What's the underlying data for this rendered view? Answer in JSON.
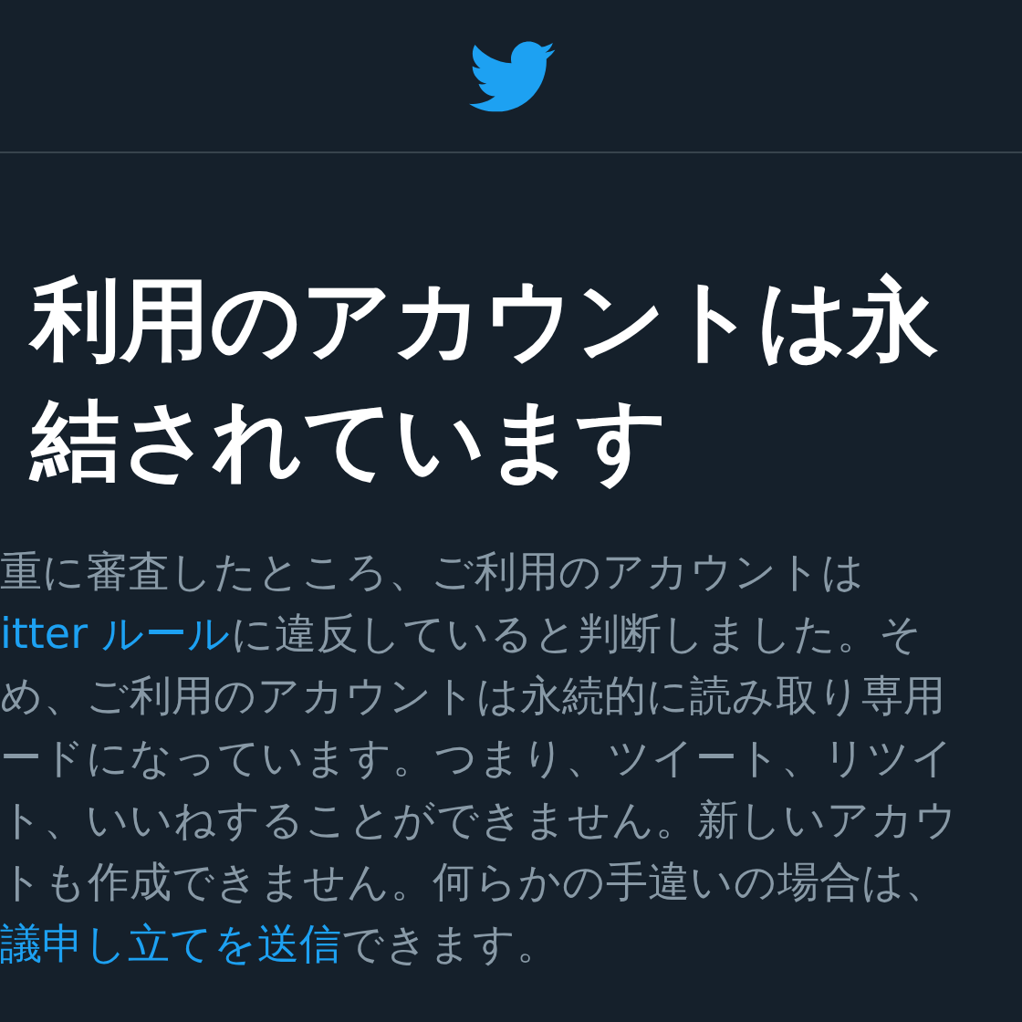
{
  "heading_lines": [
    "利用のアカウントは永",
    "結されています"
  ],
  "body_lines": [
    {
      "segments": [
        {
          "kind": "text",
          "text": "重に審査したところ、ご利用のアカウントは"
        }
      ]
    },
    {
      "segments": [
        {
          "kind": "link",
          "text": "itter ルール"
        },
        {
          "kind": "text",
          "text": "に違反していると判断しました。そ"
        }
      ]
    },
    {
      "segments": [
        {
          "kind": "text",
          "text": "め、ご利用のアカウントは永続的に読み取り専用"
        }
      ]
    },
    {
      "segments": [
        {
          "kind": "text",
          "text": "ードになっています。つまり、ツイート、リツイ"
        }
      ]
    },
    {
      "segments": [
        {
          "kind": "text",
          "text": "ト、いいねすることができません。新しいアカウ"
        }
      ]
    },
    {
      "segments": [
        {
          "kind": "text",
          "text": "トも作成できません。何らかの手違いの場合は、"
        }
      ]
    },
    {
      "segments": [
        {
          "kind": "link",
          "text": "議申し立てを送信"
        },
        {
          "kind": "text",
          "text": "できます。"
        }
      ]
    }
  ]
}
